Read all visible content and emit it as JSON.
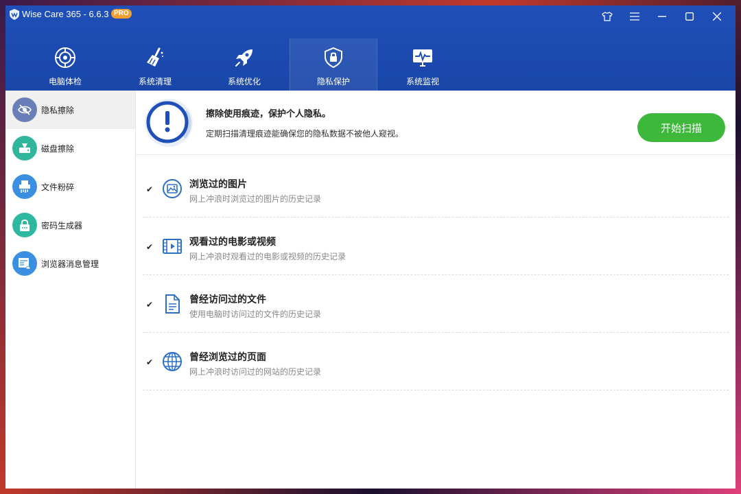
{
  "window": {
    "app_title": "Wise Care 365 - 6.6.3",
    "badge": "PRO",
    "controls": [
      "shirt-icon",
      "menu-icon",
      "minimize-icon",
      "maximize-icon",
      "close-icon"
    ]
  },
  "nav": {
    "tabs": [
      {
        "label": "电脑体检",
        "icon": "target-icon"
      },
      {
        "label": "系统清理",
        "icon": "broom-icon"
      },
      {
        "label": "系统优化",
        "icon": "rocket-icon"
      },
      {
        "label": "隐私保护",
        "icon": "lock-shield-icon",
        "active": true
      },
      {
        "label": "系统监视",
        "icon": "monitor-pulse-icon"
      }
    ]
  },
  "sidebar": {
    "items": [
      {
        "label": "隐私擦除",
        "icon": "eye-slash-icon",
        "color": "#6a7fb8",
        "active": true
      },
      {
        "label": "磁盘擦除",
        "icon": "disk-wipe-icon",
        "color": "#2fb59a"
      },
      {
        "label": "文件粉碎",
        "icon": "shredder-icon",
        "color": "#3a8fe0"
      },
      {
        "label": "密码生成器",
        "icon": "lock-icon",
        "color": "#2fb8a0"
      },
      {
        "label": "浏览器消息管理",
        "icon": "browser-bell-icon",
        "color": "#3a8fe0"
      }
    ]
  },
  "header": {
    "title": "擦除使用痕迹，保护个人隐私。",
    "description": "定期扫描清理痕迹能确保您的隐私数据不被他人窥视。",
    "scan_button": "开始扫描"
  },
  "items": [
    {
      "title": "浏览过的图片",
      "description": "网上冲浪时浏览过的图片的历史记录",
      "icon": "image-icon",
      "checked": true
    },
    {
      "title": "观看过的电影或视频",
      "description": "网上冲浪时观看过的电影或视频的历史记录",
      "icon": "film-icon",
      "checked": true
    },
    {
      "title": "曾经访问过的文件",
      "description": "使用电脑时访问过的文件的历史记录",
      "icon": "document-icon",
      "checked": true
    },
    {
      "title": "曾经浏览过的页面",
      "description": "网上冲浪时访问过的网站的历史记录",
      "icon": "globe-icon",
      "checked": true
    }
  ],
  "colors": {
    "topbar": "#1f4fb8",
    "accent_green": "#3db83a",
    "icon_blue": "#2a6fc8"
  }
}
